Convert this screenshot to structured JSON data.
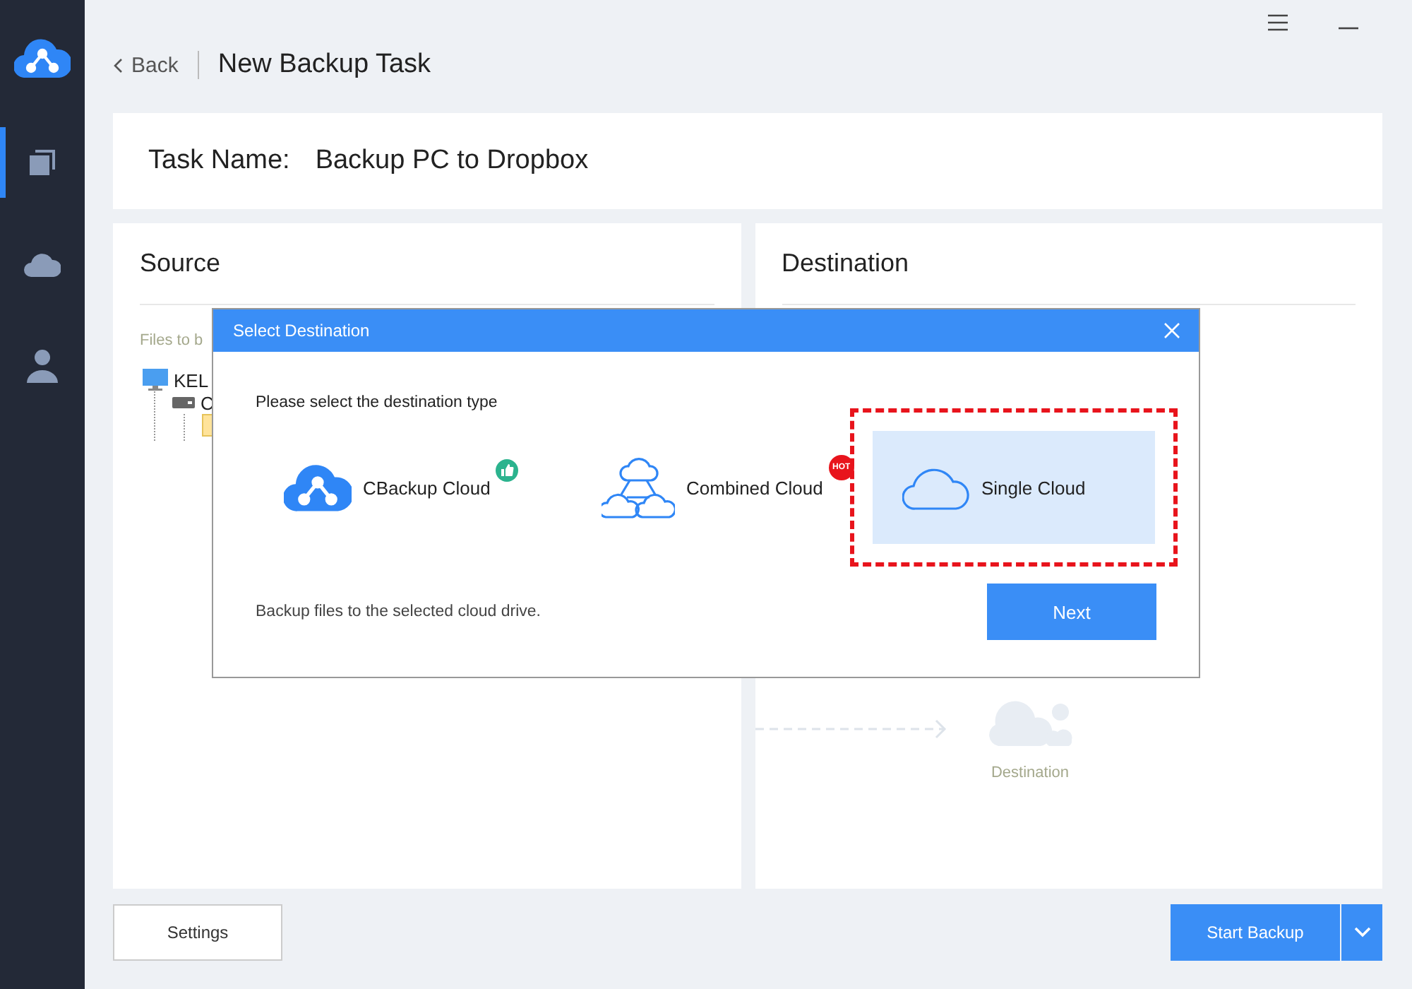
{
  "sidebar": {
    "items": [
      {
        "kind": "tasks",
        "selected": true
      },
      {
        "kind": "cloud",
        "selected": false
      },
      {
        "kind": "account",
        "selected": false
      }
    ]
  },
  "header": {
    "back": "Back",
    "title": "New Backup Task"
  },
  "task_name": {
    "label": "Task Name:",
    "value": "Backup PC to Dropbox"
  },
  "source": {
    "title": "Source",
    "hint": "Files to b",
    "tree": [
      {
        "label": "KEL",
        "kind": "computer",
        "children": [
          {
            "label": "C",
            "kind": "drive",
            "children": [
              {
                "kind": "folder"
              }
            ]
          }
        ]
      }
    ]
  },
  "destination": {
    "title": "Destination",
    "placeholder_label": "Destination"
  },
  "dialog": {
    "title": "Select Destination",
    "prompt": "Please select the destination type",
    "options": [
      {
        "label": "CBackup Cloud",
        "kind": "cbackup",
        "selected": false,
        "badge": {
          "kind": "thumb"
        }
      },
      {
        "label": "Combined Cloud",
        "kind": "combined",
        "selected": false,
        "badge": {
          "kind": "hot",
          "text": "HOT"
        }
      },
      {
        "label": "Single Cloud",
        "kind": "single",
        "selected": true
      }
    ],
    "description": "Backup files to the selected cloud drive.",
    "next": "Next"
  },
  "footer": {
    "settings": "Settings",
    "start": "Start Backup"
  }
}
